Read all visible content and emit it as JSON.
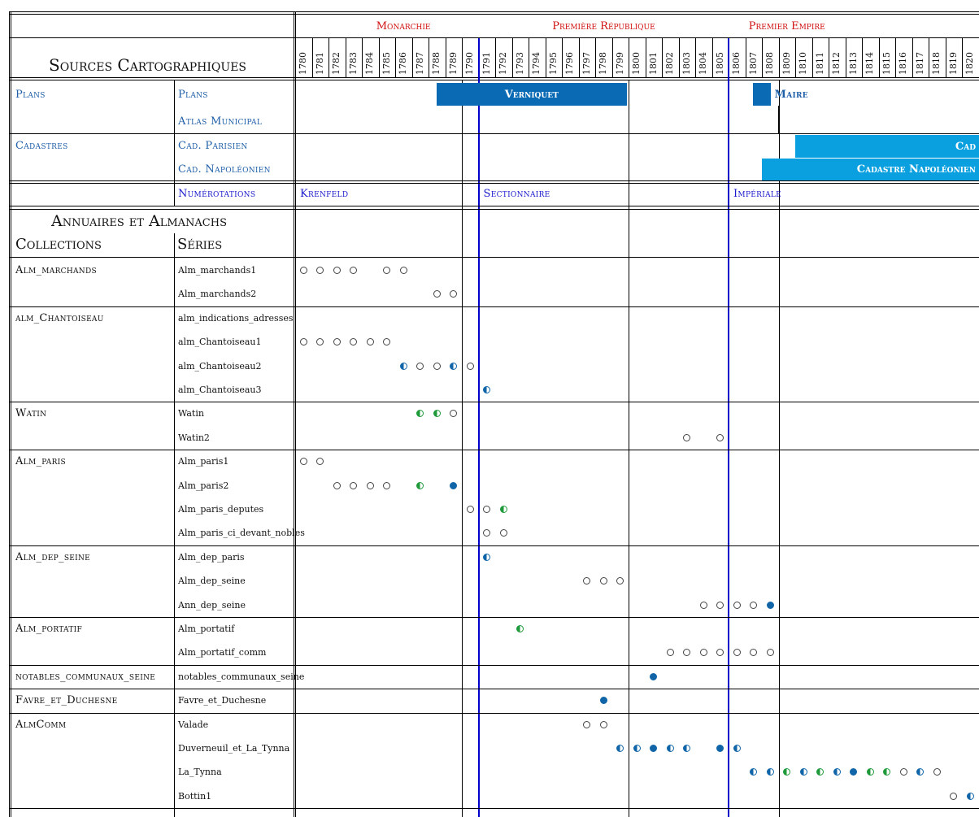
{
  "periods": [
    {
      "label": "Monarchie",
      "year": 1786
    },
    {
      "label": "Première République",
      "year": 1798
    },
    {
      "label": "Premier Empire",
      "year": 1809
    }
  ],
  "years": [
    1780,
    1781,
    1782,
    1783,
    1784,
    1785,
    1786,
    1787,
    1788,
    1789,
    1790,
    1791,
    1792,
    1793,
    1794,
    1795,
    1796,
    1797,
    1798,
    1799,
    1800,
    1801,
    1802,
    1803,
    1804,
    1805,
    1806,
    1807,
    1808,
    1809,
    1810,
    1811,
    1812,
    1813,
    1814,
    1815,
    1816,
    1817,
    1818,
    1819,
    1820
  ],
  "header": {
    "title": "Sources Cartographiques",
    "annuaires_title": "Annuaires et Almanachs",
    "collections_label": "Collections",
    "series_label": "Séries"
  },
  "carto": {
    "plans_col": "Plans",
    "plans_row1": "Plans",
    "plans_row2": "Atlas Municipal",
    "cadastres_col": "Cadastres",
    "cad_row1": "Cad. Parisien",
    "cad_row2": "Cad. Napoléonien",
    "numerotations": "Numérotations"
  },
  "bars": [
    {
      "label": "Verniquet",
      "start": 1789,
      "end": 1799,
      "row": 0,
      "color": "#0a6ab4"
    },
    {
      "label": "",
      "start": 1808,
      "end": 1808,
      "row": 0,
      "color": "#0a6ab4"
    },
    {
      "label": "Cad",
      "start": 1810,
      "end": 1821,
      "row": 1,
      "color": "#0aa0e0",
      "align": "right"
    },
    {
      "label": "Cadastre Napoléonien",
      "start": 1808,
      "end": 1821,
      "row": 2,
      "color": "#0aa0e0",
      "align": "right"
    }
  ],
  "bar_labels": [
    {
      "label": "Maire",
      "year": 1809,
      "row": 0
    }
  ],
  "numerotation_labels": [
    {
      "label": "Krenfeld",
      "year": 1780
    },
    {
      "label": "Sectionnaire",
      "year": 1791
    },
    {
      "label": "Impériale",
      "year": 1806
    }
  ],
  "collections": [
    {
      "name": "Alm_marchands",
      "series": [
        {
          "name": "Alm_marchands1",
          "marks": [
            [
              1780,
              "e"
            ],
            [
              1781,
              "e"
            ],
            [
              1782,
              "e"
            ],
            [
              1783,
              "e"
            ],
            [
              1785,
              "e"
            ],
            [
              1786,
              "e"
            ]
          ]
        },
        {
          "name": "Alm_marchands2",
          "marks": [
            [
              1788,
              "e"
            ],
            [
              1789,
              "e"
            ]
          ]
        }
      ]
    },
    {
      "name": "alm_Chantoiseau",
      "series": [
        {
          "name": "alm_indications_adresses",
          "marks": []
        },
        {
          "name": "alm_Chantoiseau1",
          "marks": [
            [
              1780,
              "e"
            ],
            [
              1781,
              "e"
            ],
            [
              1782,
              "e"
            ],
            [
              1783,
              "e"
            ],
            [
              1784,
              "e"
            ],
            [
              1785,
              "e"
            ]
          ]
        },
        {
          "name": "alm_Chantoiseau2",
          "marks": [
            [
              1786,
              "hb"
            ],
            [
              1787,
              "e"
            ],
            [
              1788,
              "e"
            ],
            [
              1789,
              "hb"
            ],
            [
              1790,
              "e"
            ]
          ]
        },
        {
          "name": "alm_Chantoiseau3",
          "marks": [
            [
              1791,
              "hb"
            ]
          ]
        }
      ]
    },
    {
      "name": "Watin",
      "series": [
        {
          "name": "Watin",
          "marks": [
            [
              1787,
              "hg"
            ],
            [
              1788,
              "hg"
            ],
            [
              1789,
              "e"
            ]
          ]
        },
        {
          "name": "Watin2",
          "marks": [
            [
              1803,
              "e"
            ],
            [
              1805,
              "e"
            ]
          ]
        }
      ]
    },
    {
      "name": "Alm_paris",
      "series": [
        {
          "name": "Alm_paris1",
          "marks": [
            [
              1780,
              "e"
            ],
            [
              1781,
              "e"
            ]
          ]
        },
        {
          "name": "Alm_paris2",
          "marks": [
            [
              1782,
              "e"
            ],
            [
              1783,
              "e"
            ],
            [
              1784,
              "e"
            ],
            [
              1785,
              "e"
            ],
            [
              1787,
              "hg"
            ],
            [
              1789,
              "f"
            ]
          ]
        },
        {
          "name": "Alm_paris_deputes",
          "marks": [
            [
              1790,
              "e"
            ],
            [
              1791,
              "e"
            ],
            [
              1792,
              "hg"
            ]
          ]
        },
        {
          "name": "Alm_paris_ci_devant_nobles",
          "marks": [
            [
              1791,
              "e"
            ],
            [
              1792,
              "e"
            ]
          ]
        }
      ]
    },
    {
      "name": "Alm_dep_seine",
      "series": [
        {
          "name": "Alm_dep_paris",
          "marks": [
            [
              1791,
              "hb"
            ]
          ]
        },
        {
          "name": "Alm_dep_seine",
          "marks": [
            [
              1797,
              "e"
            ],
            [
              1798,
              "e"
            ],
            [
              1799,
              "e"
            ]
          ]
        },
        {
          "name": "Ann_dep_seine",
          "marks": [
            [
              1804,
              "e"
            ],
            [
              1805,
              "e"
            ],
            [
              1806,
              "e"
            ],
            [
              1807,
              "e"
            ],
            [
              1808,
              "f"
            ]
          ]
        }
      ]
    },
    {
      "name": "Alm_portatif",
      "series": [
        {
          "name": "Alm_portatif",
          "marks": [
            [
              1793,
              "hg"
            ]
          ]
        },
        {
          "name": "Alm_portatif_comm",
          "marks": [
            [
              1802,
              "e"
            ],
            [
              1803,
              "e"
            ],
            [
              1804,
              "e"
            ],
            [
              1805,
              "e"
            ],
            [
              1806,
              "e"
            ],
            [
              1807,
              "e"
            ],
            [
              1808,
              "e"
            ]
          ]
        }
      ]
    },
    {
      "name": "notables_communaux_seine",
      "series": [
        {
          "name": "notables_communaux_seine",
          "marks": [
            [
              1801,
              "f"
            ]
          ]
        }
      ]
    },
    {
      "name": "Favre_et_Duchesne",
      "series": [
        {
          "name": "Favre_et_Duchesne",
          "marks": [
            [
              1798,
              "f"
            ]
          ]
        }
      ]
    },
    {
      "name": "AlmComm",
      "series": [
        {
          "name": "Valade",
          "marks": [
            [
              1797,
              "e"
            ],
            [
              1798,
              "e"
            ]
          ]
        },
        {
          "name": "Duverneuil_et_La_Tynna",
          "marks": [
            [
              1799,
              "hb"
            ],
            [
              1800,
              "hb"
            ],
            [
              1801,
              "f"
            ],
            [
              1802,
              "hb"
            ],
            [
              1803,
              "hb"
            ],
            [
              1805,
              "f"
            ],
            [
              1806,
              "hb"
            ]
          ]
        },
        {
          "name": "La_Tynna",
          "marks": [
            [
              1807,
              "hb"
            ],
            [
              1808,
              "hb"
            ],
            [
              1809,
              "hg"
            ],
            [
              1810,
              "hb"
            ],
            [
              1811,
              "hg"
            ],
            [
              1812,
              "hb"
            ],
            [
              1813,
              "f"
            ],
            [
              1814,
              "hg"
            ],
            [
              1815,
              "hg"
            ],
            [
              1816,
              "e"
            ],
            [
              1817,
              "hb"
            ],
            [
              1818,
              "e"
            ]
          ]
        },
        {
          "name": "Bottin1",
          "marks": [
            [
              1819,
              "e"
            ],
            [
              1820,
              "hb"
            ]
          ]
        }
      ]
    }
  ]
}
